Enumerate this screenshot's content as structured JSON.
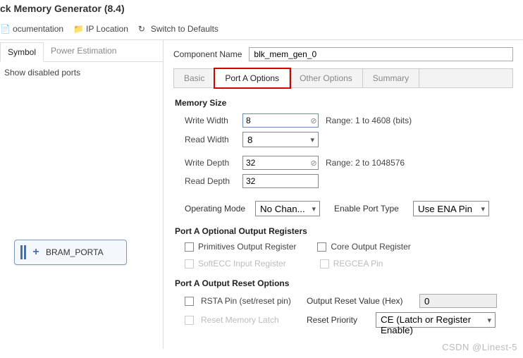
{
  "title": "ck Memory Generator (8.4)",
  "toolbar": {
    "doc": "ocumentation",
    "ip_loc": "IP Location",
    "switch": "Switch to Defaults"
  },
  "leftTabs": {
    "symbol": "Symbol",
    "power": "Power Estimation"
  },
  "showDisabled": "Show disabled ports",
  "block": {
    "label": "BRAM_PORTA"
  },
  "componentName": {
    "label": "Component Name",
    "value": "blk_mem_gen_0"
  },
  "tabs": {
    "basic": "Basic",
    "portA": "Port A Options",
    "other": "Other Options",
    "summary": "Summary"
  },
  "memSize": {
    "header": "Memory Size",
    "writeWidth": {
      "label": "Write Width",
      "value": "8",
      "range": "Range: 1 to 4608 (bits)"
    },
    "readWidth": {
      "label": "Read Width",
      "value": "8"
    },
    "writeDepth": {
      "label": "Write Depth",
      "value": "32",
      "range": "Range: 2 to 1048576"
    },
    "readDepth": {
      "label": "Read Depth",
      "value": "32"
    }
  },
  "operating": {
    "label": "Operating Mode",
    "value": "No Chan..."
  },
  "enablePort": {
    "label": "Enable Port Type",
    "value": "Use ENA Pin"
  },
  "optRegs": {
    "header": "Port A Optional Output Registers",
    "prim": "Primitives Output Register",
    "core": "Core Output Register",
    "softecc": "SoftECC Input Register",
    "regcea": "REGCEA Pin"
  },
  "reset": {
    "header": "Port A Output Reset Options",
    "rsta": "RSTA Pin (set/reset pin)",
    "outHexLabel": "Output Reset Value (Hex)",
    "outHexValue": "0",
    "memLatch": "Reset Memory Latch",
    "priorityLabel": "Reset Priority",
    "priorityValue": "CE (Latch or Register Enable)"
  },
  "watermark": "CSDN @Linest-5"
}
